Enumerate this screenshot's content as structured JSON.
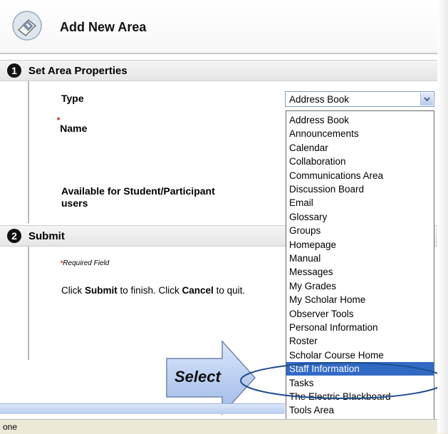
{
  "header": {
    "title": "Add New Area",
    "icon": "book-page-icon"
  },
  "section1": {
    "step": "1",
    "title": "Set Area Properties",
    "type_label": "Type",
    "name_star": "*",
    "name_label": "Name",
    "available_label_line1": "Available for Student/Participant",
    "available_label_line2": "users"
  },
  "type_select": {
    "value": "Address Book",
    "options": [
      "Address Book",
      "Announcements",
      "Calendar",
      "Collaboration",
      "Communications Area",
      "Discussion Board",
      "Email",
      "Glossary",
      "Groups",
      "Homepage",
      "Manual",
      "Messages",
      "My Grades",
      "My Scholar Home",
      "Observer Tools",
      "Personal Information",
      "Roster",
      "Scholar Course Home",
      "Staff Information",
      "Tasks",
      "The Electric Blackboard",
      "Tools Area"
    ],
    "highlighted": "Staff Information"
  },
  "section2": {
    "step": "2",
    "title": "Submit",
    "required_star": "*",
    "required_text": "Required Field",
    "instr_click1": "Click ",
    "instr_submit": "Submit",
    "instr_mid": " to finish. Click ",
    "instr_cancel": "Cancel",
    "instr_end": " to quit."
  },
  "callout": {
    "label": "Select"
  },
  "statusbar": {
    "text": "one"
  },
  "colors": {
    "highlight": "#316ac5",
    "callout_arrow": "#b7cdf3",
    "ellipse": "#1f4f8f"
  }
}
